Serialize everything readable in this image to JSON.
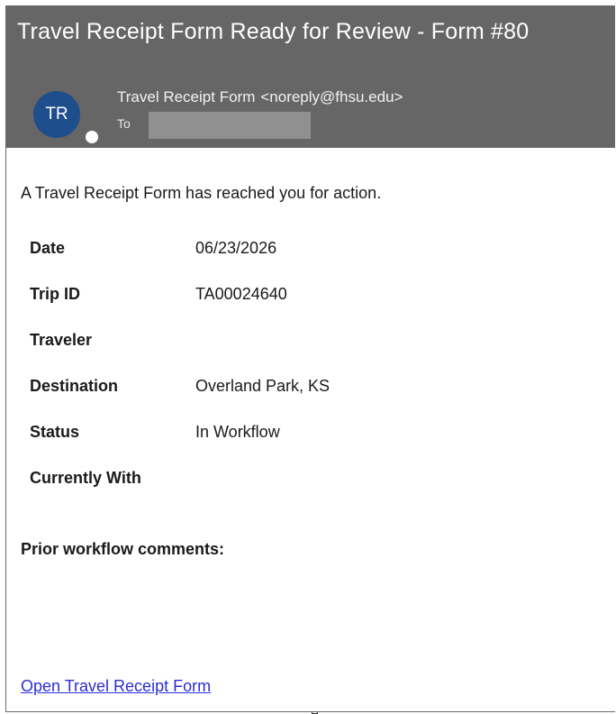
{
  "email": {
    "subject": "Travel Receipt Form Ready for Review - Form #80",
    "avatar_initials": "TR",
    "sender_name": "Travel Receipt Form",
    "sender_address": "<noreply@fhsu.edu>",
    "to_label": "To"
  },
  "body": {
    "intro": "A Travel Receipt Form has reached you for action.",
    "details": [
      {
        "label": "Date",
        "value": "06/23/2026"
      },
      {
        "label": "Trip ID",
        "value": "TA00024640"
      },
      {
        "label": "Traveler",
        "value": ""
      },
      {
        "label": "Destination",
        "value": "Overland Park, KS"
      },
      {
        "label": "Status",
        "value": "In Workflow"
      },
      {
        "label": "Currently With",
        "value": ""
      }
    ],
    "comments_label": "Prior workflow comments:",
    "link_text": "Open Travel Receipt Form"
  },
  "colors": {
    "header_bg": "#666666",
    "avatar_bg": "#1f4e8c",
    "link": "#2c2cd8"
  }
}
